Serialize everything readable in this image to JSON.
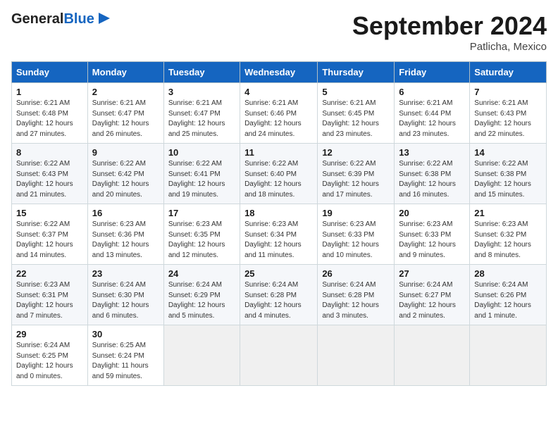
{
  "header": {
    "logo_general": "General",
    "logo_blue": "Blue",
    "month": "September 2024",
    "location": "Patlicha, Mexico"
  },
  "days_of_week": [
    "Sunday",
    "Monday",
    "Tuesday",
    "Wednesday",
    "Thursday",
    "Friday",
    "Saturday"
  ],
  "weeks": [
    [
      {
        "day": "1",
        "info": "Sunrise: 6:21 AM\nSunset: 6:48 PM\nDaylight: 12 hours\nand 27 minutes."
      },
      {
        "day": "2",
        "info": "Sunrise: 6:21 AM\nSunset: 6:47 PM\nDaylight: 12 hours\nand 26 minutes."
      },
      {
        "day": "3",
        "info": "Sunrise: 6:21 AM\nSunset: 6:47 PM\nDaylight: 12 hours\nand 25 minutes."
      },
      {
        "day": "4",
        "info": "Sunrise: 6:21 AM\nSunset: 6:46 PM\nDaylight: 12 hours\nand 24 minutes."
      },
      {
        "day": "5",
        "info": "Sunrise: 6:21 AM\nSunset: 6:45 PM\nDaylight: 12 hours\nand 23 minutes."
      },
      {
        "day": "6",
        "info": "Sunrise: 6:21 AM\nSunset: 6:44 PM\nDaylight: 12 hours\nand 23 minutes."
      },
      {
        "day": "7",
        "info": "Sunrise: 6:21 AM\nSunset: 6:43 PM\nDaylight: 12 hours\nand 22 minutes."
      }
    ],
    [
      {
        "day": "8",
        "info": "Sunrise: 6:22 AM\nSunset: 6:43 PM\nDaylight: 12 hours\nand 21 minutes."
      },
      {
        "day": "9",
        "info": "Sunrise: 6:22 AM\nSunset: 6:42 PM\nDaylight: 12 hours\nand 20 minutes."
      },
      {
        "day": "10",
        "info": "Sunrise: 6:22 AM\nSunset: 6:41 PM\nDaylight: 12 hours\nand 19 minutes."
      },
      {
        "day": "11",
        "info": "Sunrise: 6:22 AM\nSunset: 6:40 PM\nDaylight: 12 hours\nand 18 minutes."
      },
      {
        "day": "12",
        "info": "Sunrise: 6:22 AM\nSunset: 6:39 PM\nDaylight: 12 hours\nand 17 minutes."
      },
      {
        "day": "13",
        "info": "Sunrise: 6:22 AM\nSunset: 6:38 PM\nDaylight: 12 hours\nand 16 minutes."
      },
      {
        "day": "14",
        "info": "Sunrise: 6:22 AM\nSunset: 6:38 PM\nDaylight: 12 hours\nand 15 minutes."
      }
    ],
    [
      {
        "day": "15",
        "info": "Sunrise: 6:22 AM\nSunset: 6:37 PM\nDaylight: 12 hours\nand 14 minutes."
      },
      {
        "day": "16",
        "info": "Sunrise: 6:23 AM\nSunset: 6:36 PM\nDaylight: 12 hours\nand 13 minutes."
      },
      {
        "day": "17",
        "info": "Sunrise: 6:23 AM\nSunset: 6:35 PM\nDaylight: 12 hours\nand 12 minutes."
      },
      {
        "day": "18",
        "info": "Sunrise: 6:23 AM\nSunset: 6:34 PM\nDaylight: 12 hours\nand 11 minutes."
      },
      {
        "day": "19",
        "info": "Sunrise: 6:23 AM\nSunset: 6:33 PM\nDaylight: 12 hours\nand 10 minutes."
      },
      {
        "day": "20",
        "info": "Sunrise: 6:23 AM\nSunset: 6:33 PM\nDaylight: 12 hours\nand 9 minutes."
      },
      {
        "day": "21",
        "info": "Sunrise: 6:23 AM\nSunset: 6:32 PM\nDaylight: 12 hours\nand 8 minutes."
      }
    ],
    [
      {
        "day": "22",
        "info": "Sunrise: 6:23 AM\nSunset: 6:31 PM\nDaylight: 12 hours\nand 7 minutes."
      },
      {
        "day": "23",
        "info": "Sunrise: 6:24 AM\nSunset: 6:30 PM\nDaylight: 12 hours\nand 6 minutes."
      },
      {
        "day": "24",
        "info": "Sunrise: 6:24 AM\nSunset: 6:29 PM\nDaylight: 12 hours\nand 5 minutes."
      },
      {
        "day": "25",
        "info": "Sunrise: 6:24 AM\nSunset: 6:28 PM\nDaylight: 12 hours\nand 4 minutes."
      },
      {
        "day": "26",
        "info": "Sunrise: 6:24 AM\nSunset: 6:28 PM\nDaylight: 12 hours\nand 3 minutes."
      },
      {
        "day": "27",
        "info": "Sunrise: 6:24 AM\nSunset: 6:27 PM\nDaylight: 12 hours\nand 2 minutes."
      },
      {
        "day": "28",
        "info": "Sunrise: 6:24 AM\nSunset: 6:26 PM\nDaylight: 12 hours\nand 1 minute."
      }
    ],
    [
      {
        "day": "29",
        "info": "Sunrise: 6:24 AM\nSunset: 6:25 PM\nDaylight: 12 hours\nand 0 minutes."
      },
      {
        "day": "30",
        "info": "Sunrise: 6:25 AM\nSunset: 6:24 PM\nDaylight: 11 hours\nand 59 minutes."
      },
      {
        "day": "",
        "info": ""
      },
      {
        "day": "",
        "info": ""
      },
      {
        "day": "",
        "info": ""
      },
      {
        "day": "",
        "info": ""
      },
      {
        "day": "",
        "info": ""
      }
    ]
  ]
}
